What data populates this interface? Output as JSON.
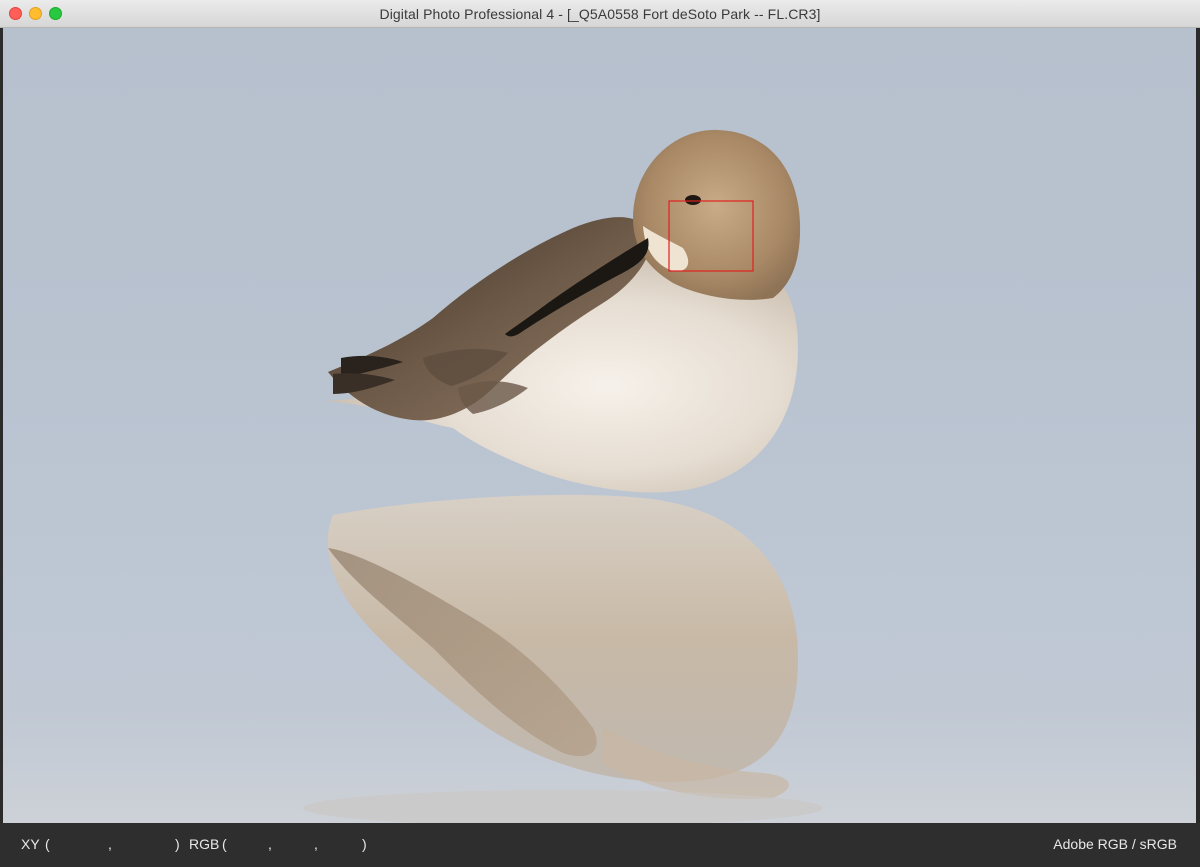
{
  "window": {
    "title": "Digital Photo Professional 4 - [_Q5A0558 Fort deSoto Park -- FL.CR3]"
  },
  "status_bar": {
    "xy_label": "XY",
    "xy_open": "(",
    "xy_sep": ",",
    "xy_close": ")",
    "rgb_label": "RGB",
    "rgb_open": "(",
    "rgb_sep1": ",",
    "rgb_sep2": ",",
    "rgb_close": ")",
    "color_space": "Adobe RGB / sRGB"
  },
  "image": {
    "subject": "sandpiper-bird-with-reflection",
    "af_point_color": "#e02020"
  },
  "colors": {
    "titlebar": "#e0e0e0",
    "statusbar": "#2e2e2e",
    "background_water": "#b9c3d0"
  }
}
